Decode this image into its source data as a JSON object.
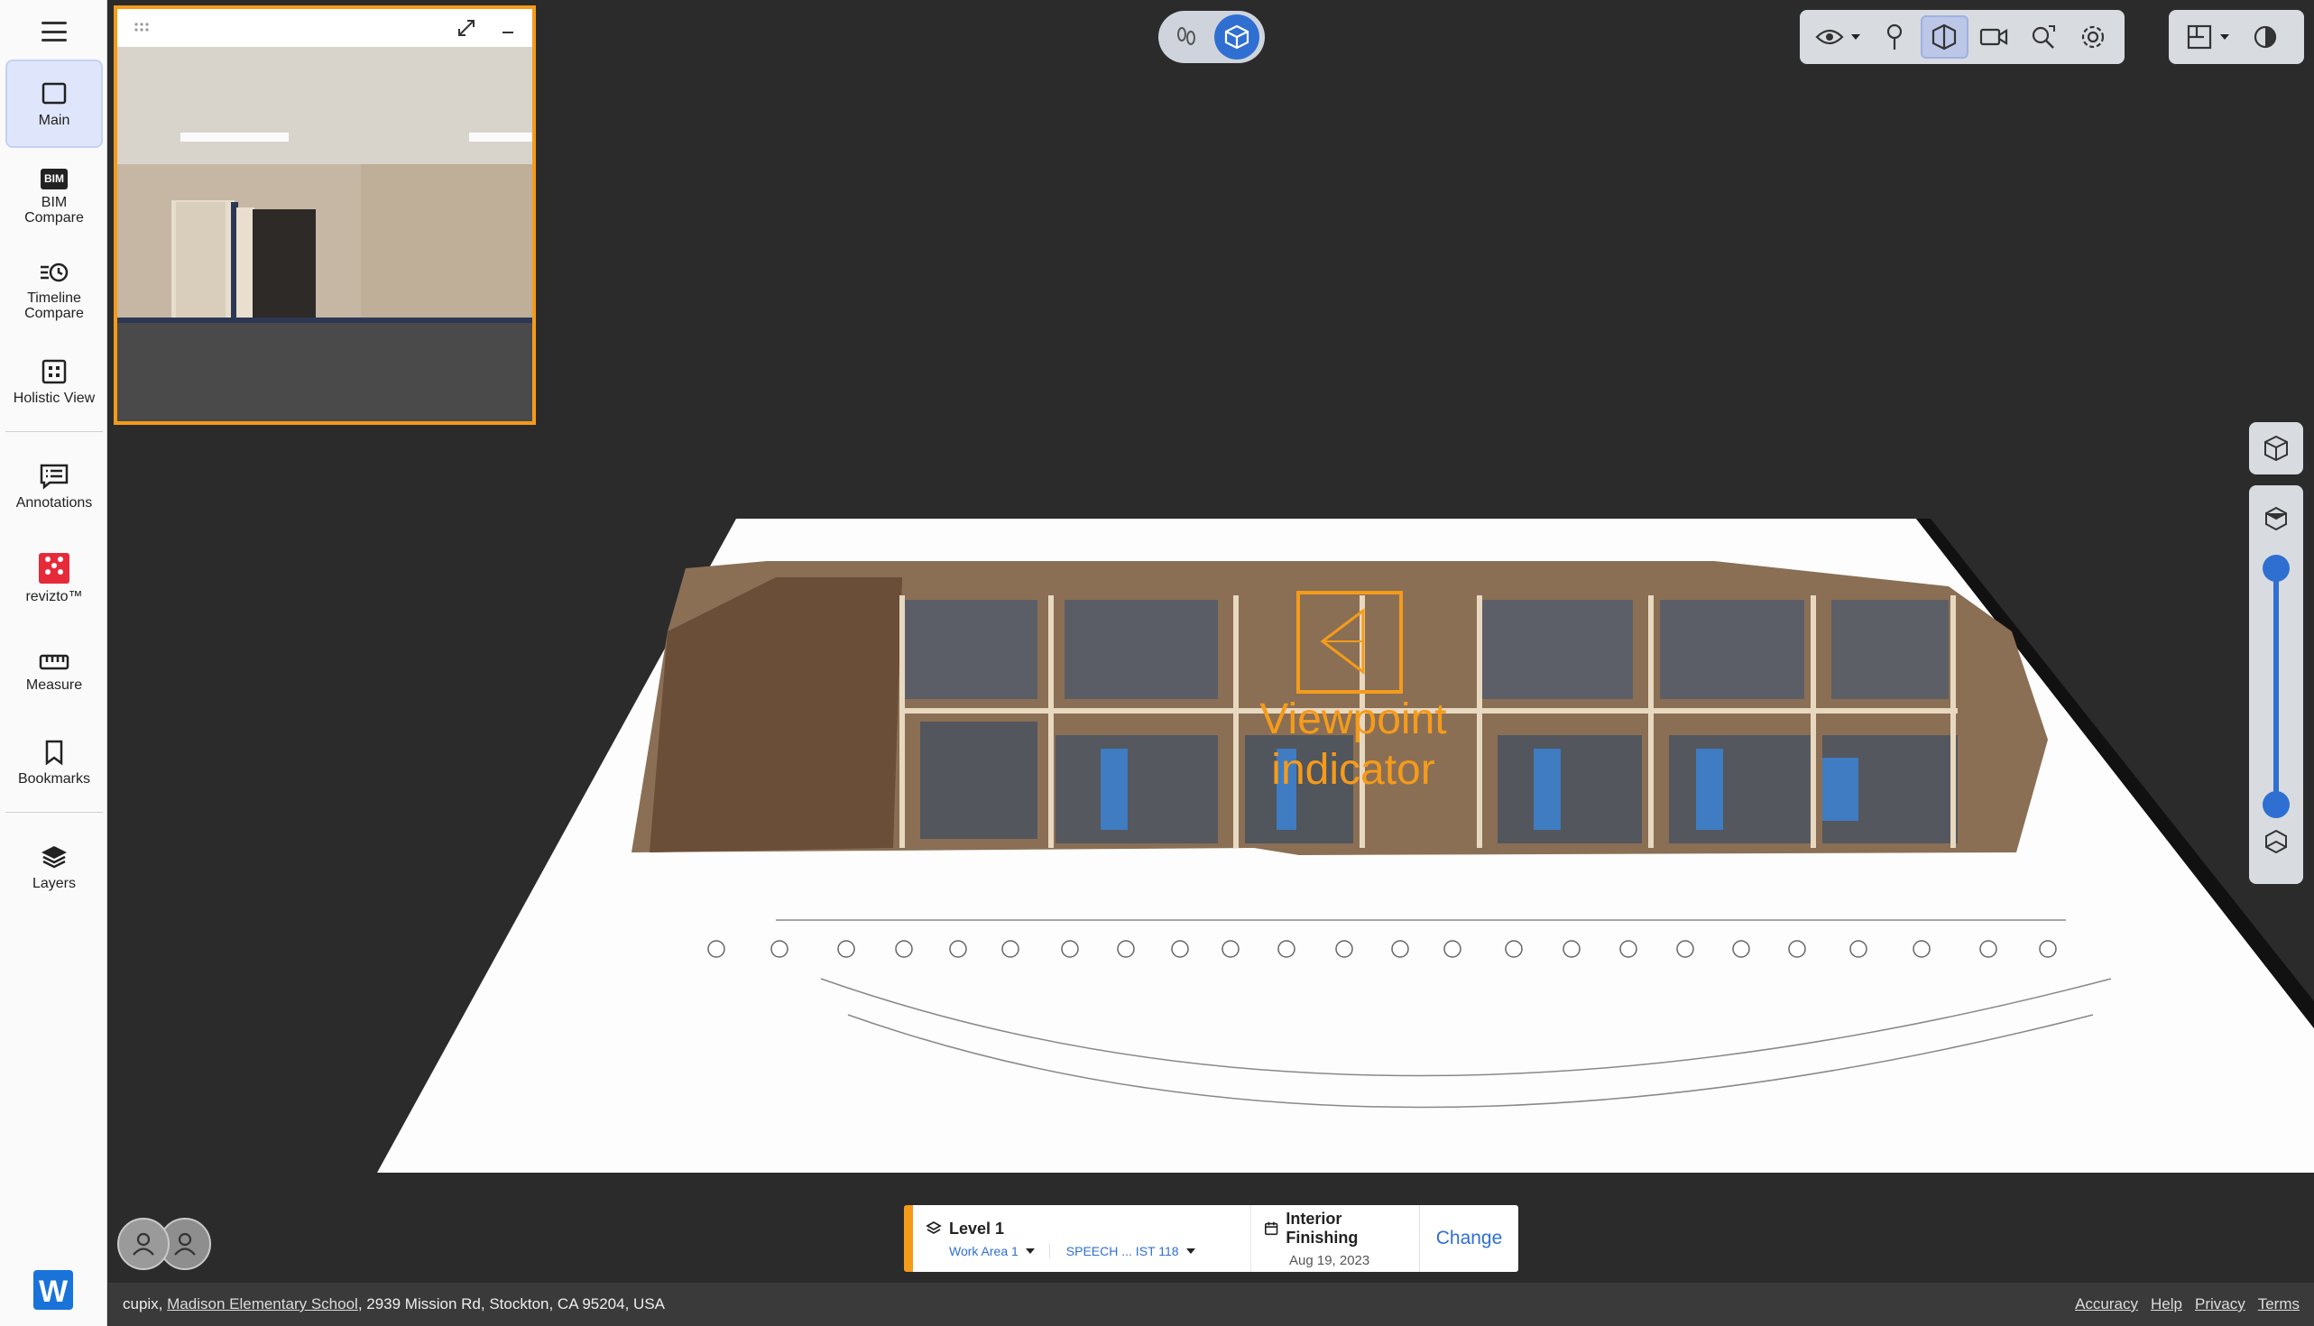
{
  "sidebar": {
    "items": [
      {
        "label": "Main",
        "icon": "square-icon",
        "active": true
      },
      {
        "label": "BIM Compare",
        "icon": "bim-icon"
      },
      {
        "label": "Timeline Compare",
        "icon": "timeline-icon"
      },
      {
        "label": "Holistic View",
        "icon": "grid-icon"
      },
      {
        "label": "Annotations",
        "icon": "annotation-icon"
      },
      {
        "label": "revizto™",
        "icon": "revizto-icon"
      },
      {
        "label": "Measure",
        "icon": "ruler-icon"
      },
      {
        "label": "Bookmarks",
        "icon": "bookmark-icon"
      },
      {
        "label": "Layers",
        "icon": "layers-icon"
      }
    ],
    "bim_badge": "BIM",
    "logo_letter": "W"
  },
  "viewer": {
    "annotation": "Viewpoint indicator"
  },
  "level_panel": {
    "level": "Level 1",
    "work_area": "Work Area 1",
    "room": "SPEECH ... IST 118",
    "stage": "Interior Finishing",
    "date": "Aug 19, 2023",
    "change_label": "Change"
  },
  "footer": {
    "prefix": "cupix, ",
    "site_name": "Madison Elementary School",
    "address": ", 2939 Mission Rd, Stockton, CA 95204, USA",
    "links": [
      "Accuracy",
      "Help",
      "Privacy",
      "Terms"
    ]
  },
  "colors": {
    "accent_orange": "#f59b1a",
    "accent_blue": "#2f6fd1",
    "background": "#2b2b2b"
  }
}
